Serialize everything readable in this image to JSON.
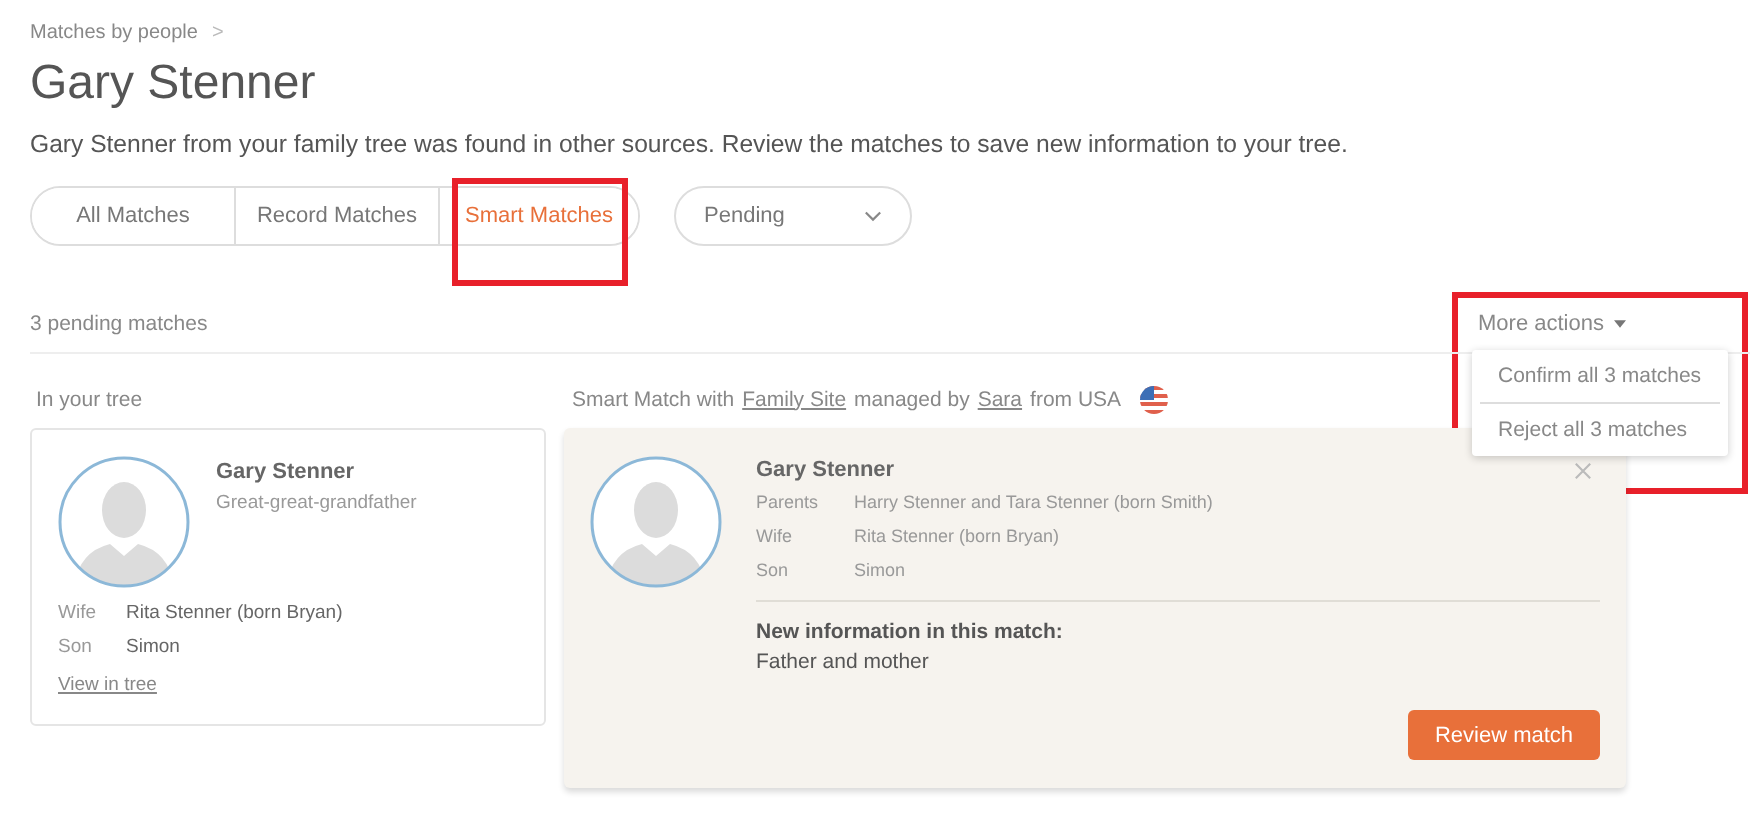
{
  "breadcrumb": {
    "label": "Matches by people",
    "separator": ">"
  },
  "title": "Gary Stenner",
  "description": "Gary Stenner from your family tree was found in other sources. Review the matches to save new information to your tree.",
  "tabs": [
    {
      "label": "All Matches",
      "selected": false
    },
    {
      "label": "Record Matches",
      "selected": false
    },
    {
      "label": "Smart Matches",
      "selected": true
    }
  ],
  "status_filter": {
    "value": "Pending"
  },
  "pending_count": "3 pending matches",
  "more_actions": {
    "label": "More actions",
    "expanded": true,
    "items": [
      "Confirm all 3 matches",
      "Reject all 3 matches"
    ]
  },
  "tree_panel": {
    "heading": "In your tree",
    "name": "Gary Stenner",
    "relation": "Great-great-grandfather",
    "relatives": [
      {
        "label": "Wife",
        "value": "Rita Stenner (born Bryan)"
      },
      {
        "label": "Son",
        "value": "Simon"
      }
    ],
    "link": "View in tree"
  },
  "match_panel": {
    "heading_parts": [
      {
        "kind": "text",
        "text": "Smart Match with"
      },
      {
        "kind": "link",
        "text": "Family Site"
      },
      {
        "kind": "text",
        "text": "managed by"
      },
      {
        "kind": "link",
        "text": "Sara"
      },
      {
        "kind": "text",
        "text": "from USA"
      }
    ],
    "name": "Gary Stenner",
    "relatives": [
      {
        "label": "Parents",
        "value": "Harry Stenner and Tara Stenner (born Smith)"
      },
      {
        "label": "Wife",
        "value": "Rita Stenner (born Bryan)"
      },
      {
        "label": "Son",
        "value": "Simon"
      }
    ],
    "new_info_title": "New information in this match:",
    "new_info": "Father and mother",
    "button": "Review match"
  }
}
